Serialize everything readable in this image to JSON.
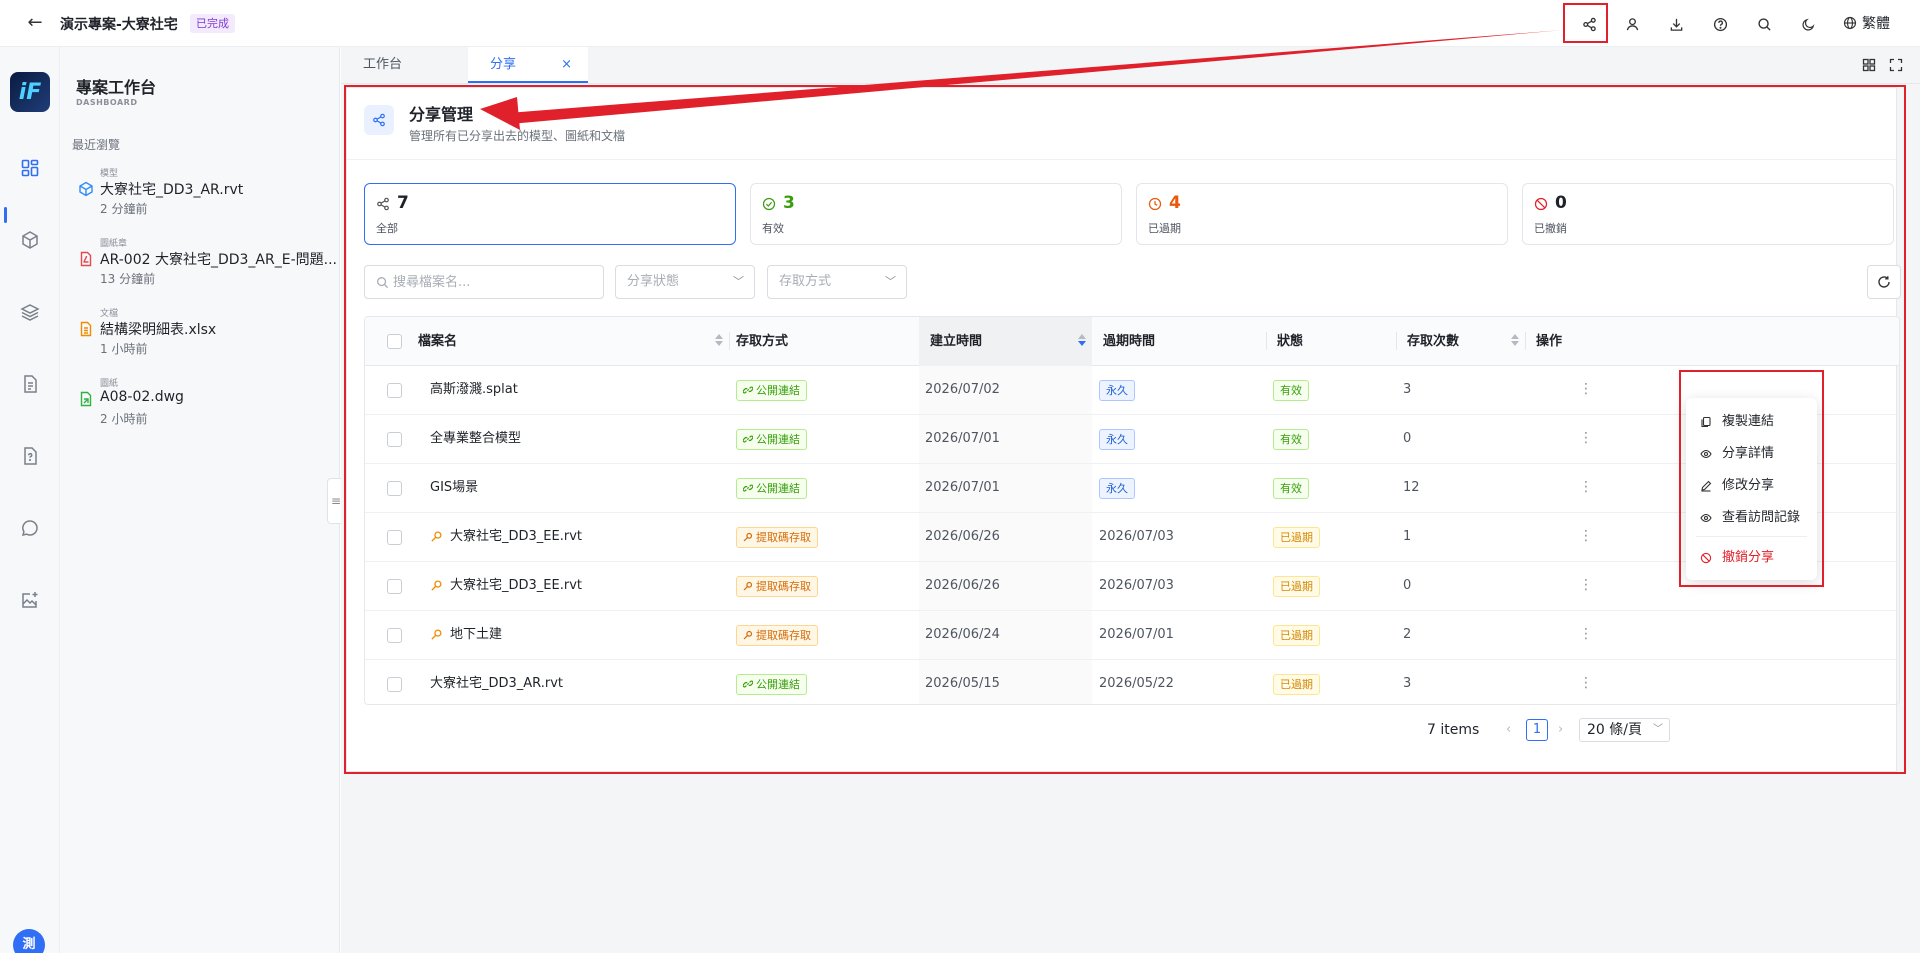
{
  "header": {
    "project_title": "演示專案-大寮社宅",
    "status_badge": "已完成",
    "language": "繁體",
    "icons": [
      "share-icon",
      "user-switch-icon",
      "download-icon",
      "help-icon",
      "search-icon",
      "moon-icon",
      "globe-icon"
    ]
  },
  "rail": {
    "icons": [
      "dashboard-icon",
      "cube-icon",
      "layers-icon",
      "document-icon",
      "file-question-icon",
      "chat-icon",
      "image-add-icon"
    ],
    "avatar_text": "測"
  },
  "sidebar": {
    "title": "專案工作台",
    "subtitle": "DASHBOARD",
    "section_label": "最近瀏覽",
    "recent": [
      {
        "type": "模型",
        "name": "大寮社宅_DD3_AR.rvt",
        "time": "2 分鐘前",
        "icon": "cube-icon"
      },
      {
        "type": "圖紙章",
        "name": "AR-002 大寮社宅_DD3_AR_E-問題...",
        "time": "13 分鐘前",
        "icon": "pdf-icon"
      },
      {
        "type": "文檔",
        "name": "結構梁明細表.xlsx",
        "time": "1 小時前",
        "icon": "sheet-icon"
      },
      {
        "type": "圖紙",
        "name": "A08-02.dwg",
        "time": "2 小時前",
        "icon": "dwg-icon"
      }
    ]
  },
  "tabs": [
    {
      "label": "工作台"
    },
    {
      "label": "分享",
      "close": "×"
    }
  ],
  "page": {
    "title": "分享管理",
    "subtitle": "管理所有已分享出去的模型、圖紙和文檔"
  },
  "stats": [
    {
      "value": "7",
      "label": "全部",
      "color": "#1f2329",
      "icon": "share-icon"
    },
    {
      "value": "3",
      "label": "有效",
      "color": "#389e0d",
      "icon": "check-circle-icon"
    },
    {
      "value": "4",
      "label": "已過期",
      "color": "#e8590c",
      "icon": "clock-icon"
    },
    {
      "value": "0",
      "label": "已撤銷",
      "color": "#1f2329",
      "icon": "ban-icon"
    }
  ],
  "filters": {
    "search_placeholder": "搜尋檔案名...",
    "status_placeholder": "分享狀態",
    "access_placeholder": "存取方式"
  },
  "table": {
    "columns": [
      "檔案名",
      "存取方式",
      "建立時間",
      "過期時間",
      "狀態",
      "存取次數",
      "操作"
    ],
    "rows": [
      {
        "name": "高斯潑濺.splat",
        "key": false,
        "access": "公開連結",
        "access_type": "public",
        "created": "2026/07/02",
        "expires": "永久",
        "expires_tag": true,
        "status": "有效",
        "status_type": "valid",
        "count": "3"
      },
      {
        "name": "全專業整合模型",
        "key": false,
        "access": "公開連結",
        "access_type": "public",
        "created": "2026/07/01",
        "expires": "永久",
        "expires_tag": true,
        "status": "有效",
        "status_type": "valid",
        "count": "0"
      },
      {
        "name": "GIS場景",
        "key": false,
        "access": "公開連結",
        "access_type": "public",
        "created": "2026/07/01",
        "expires": "永久",
        "expires_tag": true,
        "status": "有效",
        "status_type": "valid",
        "count": "12"
      },
      {
        "name": "大寮社宅_DD3_EE.rvt",
        "key": true,
        "access": "提取碼存取",
        "access_type": "code",
        "created": "2026/06/26",
        "expires": "2026/07/03",
        "expires_tag": false,
        "status": "已過期",
        "status_type": "expired",
        "count": "1"
      },
      {
        "name": "大寮社宅_DD3_EE.rvt",
        "key": true,
        "access": "提取碼存取",
        "access_type": "code",
        "created": "2026/06/26",
        "expires": "2026/07/03",
        "expires_tag": false,
        "status": "已過期",
        "status_type": "expired",
        "count": "0"
      },
      {
        "name": "地下土建",
        "key": true,
        "access": "提取碼存取",
        "access_type": "code",
        "created": "2026/06/24",
        "expires": "2026/07/01",
        "expires_tag": false,
        "status": "已過期",
        "status_type": "expired",
        "count": "2"
      },
      {
        "name": "大寮社宅_DD3_AR.rvt",
        "key": false,
        "access": "公開連結",
        "access_type": "public",
        "created": "2026/05/15",
        "expires": "2026/05/22",
        "expires_tag": false,
        "status": "已過期",
        "status_type": "expired",
        "count": "3"
      }
    ],
    "more_icon": "⋮"
  },
  "row_menu": [
    {
      "label": "複製連結",
      "icon": "copy-icon"
    },
    {
      "label": "分享詳情",
      "icon": "eye-icon"
    },
    {
      "label": "修改分享",
      "icon": "edit-icon"
    },
    {
      "label": "查看訪問記錄",
      "icon": "eye-icon"
    },
    {
      "label": "撤銷分享",
      "icon": "ban-icon",
      "danger": true
    }
  ],
  "pagination": {
    "total": "7 items",
    "current_page": "1",
    "page_size": "20 條/頁",
    "prev": "‹",
    "next": "›"
  },
  "colors": {
    "accent": "#2f6ef5",
    "annotation_red": "#e0202a"
  }
}
